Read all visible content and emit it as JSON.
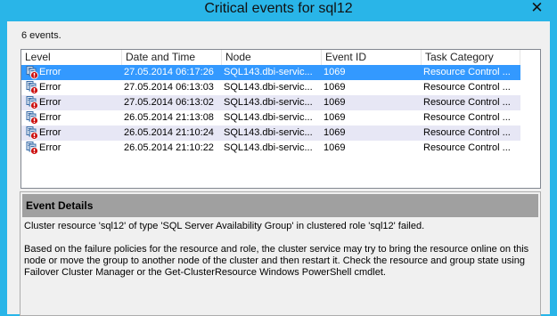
{
  "window": {
    "title": "Critical events for sql12",
    "close_label": "✕"
  },
  "summary": {
    "count_text": "6 events."
  },
  "columns": [
    "Level",
    "Date and Time",
    "Node",
    "Event ID",
    "Task Category"
  ],
  "events": [
    {
      "level": "Error",
      "date": "27.05.2014 06:17:26",
      "node": "SQL143.dbi-servic...",
      "event_id": "1069",
      "category": "Resource Control ..."
    },
    {
      "level": "Error",
      "date": "27.05.2014 06:13:03",
      "node": "SQL143.dbi-servic...",
      "event_id": "1069",
      "category": "Resource Control ..."
    },
    {
      "level": "Error",
      "date": "27.05.2014 06:13:02",
      "node": "SQL143.dbi-servic...",
      "event_id": "1069",
      "category": "Resource Control ..."
    },
    {
      "level": "Error",
      "date": "26.05.2014 21:13:08",
      "node": "SQL143.dbi-servic...",
      "event_id": "1069",
      "category": "Resource Control ..."
    },
    {
      "level": "Error",
      "date": "26.05.2014 21:10:24",
      "node": "SQL143.dbi-servic...",
      "event_id": "1069",
      "category": "Resource Control ..."
    },
    {
      "level": "Error",
      "date": "26.05.2014 21:10:22",
      "node": "SQL143.dbi-servic...",
      "event_id": "1069",
      "category": "Resource Control ..."
    }
  ],
  "details": {
    "header": "Event Details",
    "line1": "Cluster resource 'sql12' of type 'SQL Server Availability Group' in clustered role 'sql12' failed.",
    "line2": "Based on the failure policies for the resource and role, the cluster service may try to bring the resource online on this node or move the group to another node of the cluster and then restart it.  Check the resource and group state using Failover Cluster Manager or the Get-ClusterResource Windows PowerShell cmdlet."
  },
  "icons": {
    "level_icon": "cluster-error-icon"
  },
  "colors": {
    "titlebar": "#29b5e8",
    "selection": "#3399ff",
    "alt_row": "#e7e7f5",
    "details_header": "#a0a0a0"
  }
}
